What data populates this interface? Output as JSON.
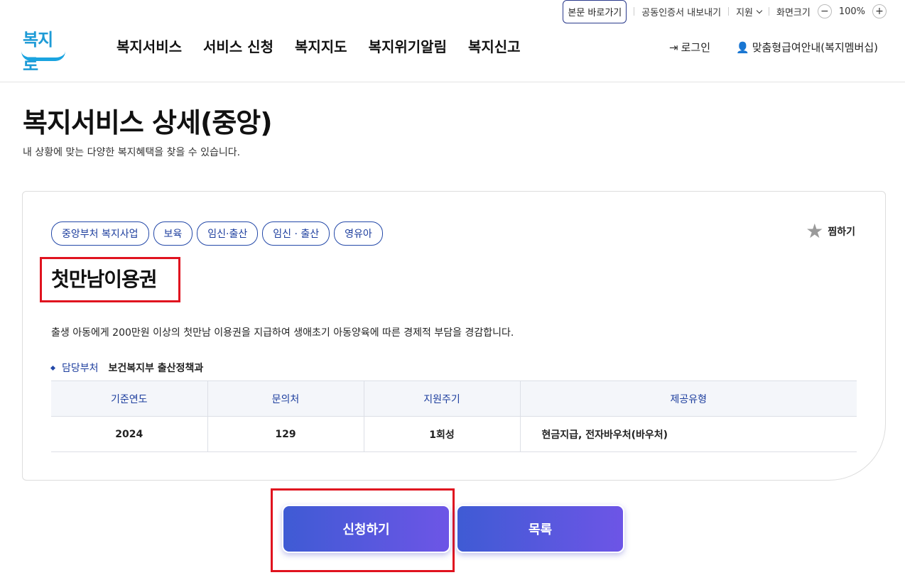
{
  "util": {
    "skip": "본문 바로가기",
    "cert": "공동인증서 내보내기",
    "support": "지원",
    "screen": "화면크기",
    "zoom_out": "−",
    "zoom": "100%",
    "zoom_in": "+"
  },
  "logo": {
    "text": "복지로"
  },
  "gnb": [
    "복지서비스",
    "서비스 신청",
    "복지지도",
    "복지위기알림",
    "복지신고"
  ],
  "header_right": {
    "login": "로그인",
    "member": "맞춤형급여안내(복지멤버십)"
  },
  "page": {
    "title": "복지서비스 상세(중앙)",
    "desc": "내 상황에 맞는 다양한 복지혜택을 찾을 수 있습니다."
  },
  "service": {
    "tags": [
      "중앙부처 복지사업",
      "보육",
      "임신·출산",
      "임신 · 출산",
      "영유아"
    ],
    "fav": "찜하기",
    "title": "첫만남이용권",
    "desc": "출생 아동에게 200만원 이상의 첫만남 이용권을 지급하여 생애초기 아동양육에 따른 경제적 부담을 경감합니다.",
    "dept_label": "담당부처",
    "dept_value": "보건복지부 출산정책과",
    "table": {
      "headers": [
        "기준연도",
        "문의처",
        "지원주기",
        "제공유형"
      ],
      "row": [
        "2024",
        "129",
        "1회성",
        "현금지급, 전자바우처(바우처)"
      ]
    }
  },
  "buttons": {
    "apply": "신청하기",
    "list": "목록"
  }
}
